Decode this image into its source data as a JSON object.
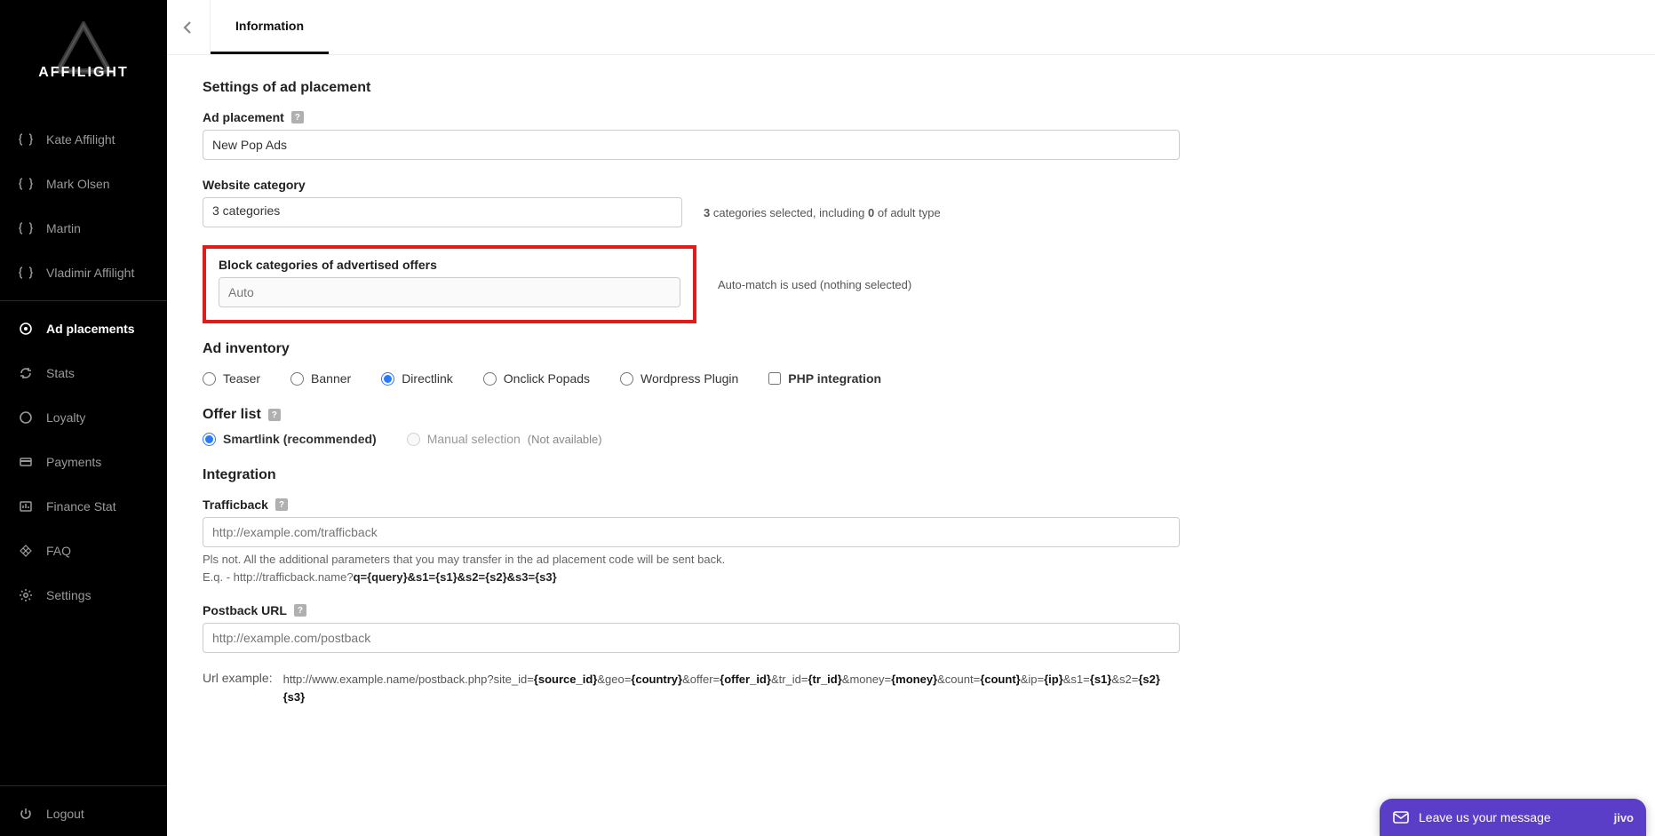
{
  "brand": "AFFILIGHT",
  "sidebar": {
    "users": [
      "Kate Affilight",
      "Mark Olsen",
      "Martin",
      "Vladimir Affilight"
    ],
    "items": {
      "ad_placements": "Ad placements",
      "stats": "Stats",
      "loyalty": "Loyalty",
      "payments": "Payments",
      "finance_stat": "Finance Stat",
      "faq": "FAQ",
      "settings": "Settings",
      "logout": "Logout"
    }
  },
  "tabs": {
    "information": "Information"
  },
  "sections": {
    "settings_title": "Settings of ad placement",
    "ad_placement": {
      "label": "Ad placement",
      "value": "New Pop Ads"
    },
    "website_category": {
      "label": "Website category",
      "value": "3 categories",
      "summary_prefix": "3",
      "summary_mid": " categories selected, including ",
      "summary_bold": "0",
      "summary_suffix": " of adult type"
    },
    "block_categories": {
      "label": "Block categories of advertised offers",
      "placeholder": "Auto",
      "note": "Auto-match is used (nothing selected)"
    },
    "ad_inventory": {
      "title": "Ad inventory",
      "options": {
        "teaser": "Teaser",
        "banner": "Banner",
        "directlink": "Directlink",
        "onclick_popads": "Onclick Popads",
        "wordpress_plugin": "Wordpress Plugin",
        "php_integration": "PHP integration"
      },
      "selected": "directlink"
    },
    "offer_list": {
      "title": "Offer list",
      "smartlink": "Smartlink (recommended)",
      "manual": "Manual selection",
      "manual_note": "(Not available)"
    },
    "integration": {
      "title": "Integration",
      "trafficback": {
        "label": "Trafficback",
        "placeholder": "http://example.com/trafficback",
        "hint_text": "Pls not. All the additional parameters that you may transfer in the ad placement code will be sent back.",
        "hint_prefix": "E.q. - http://trafficback.name?",
        "hint_bold": "q={query}&s1={s1}&s2={s2}&s3={s3}"
      },
      "postback": {
        "label": "Postback URL",
        "placeholder": "http://example.com/postback"
      },
      "url_example": {
        "label": "Url example:",
        "p1": "http://www.example.name/postback.php?site_id=",
        "b1": "{source_id}",
        "p2": "&geo=",
        "b2": "{country}",
        "p3": "&offer=",
        "b3": "{offer_id}",
        "p4": "&tr_id=",
        "b4": "{tr_id}",
        "p5": "&money=",
        "b5": "{money}",
        "p6": "&count=",
        "b6": "{count}",
        "p7": "&ip=",
        "b7": "{ip}",
        "p8": "&s1=",
        "b8": "{s1}",
        "p9": "&s2=",
        "b9": "{s2}",
        "p10_trail_bold": "{s3}"
      }
    }
  },
  "chat": {
    "message": "Leave us your message",
    "brand": "jivo"
  }
}
